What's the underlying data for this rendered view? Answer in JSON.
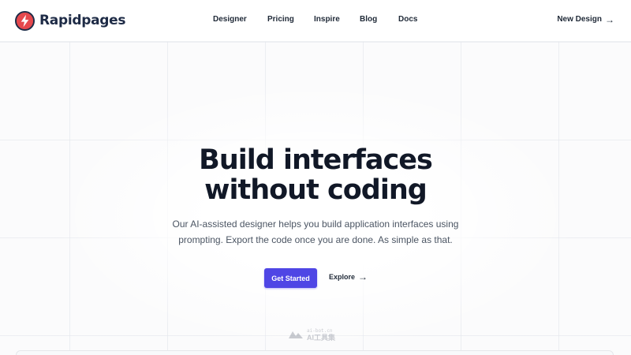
{
  "brand": {
    "name": "Rapidpages",
    "logo_icon": "lightning-bolt-icon",
    "logo_color": "#e5484d",
    "logo_ring": "#1e2b46"
  },
  "nav": {
    "links": [
      {
        "label": "Designer"
      },
      {
        "label": "Pricing"
      },
      {
        "label": "Inspire"
      },
      {
        "label": "Blog"
      },
      {
        "label": "Docs"
      }
    ],
    "cta": {
      "label": "New Design",
      "icon": "arrow-right-icon"
    }
  },
  "hero": {
    "headline_line1": "Build interfaces",
    "headline_line2": "without coding",
    "subtitle_line1": "Our AI-assisted designer helps you build application interfaces using",
    "subtitle_line2": "prompting. Export the code once you are done. As simple as that.",
    "primary_button": "Get Started",
    "secondary_button": "Explore",
    "secondary_icon": "arrow-right-icon",
    "accent_color": "#4f46e5"
  },
  "watermark": {
    "small": "ai-bot.cn",
    "big": "AI工具集"
  }
}
